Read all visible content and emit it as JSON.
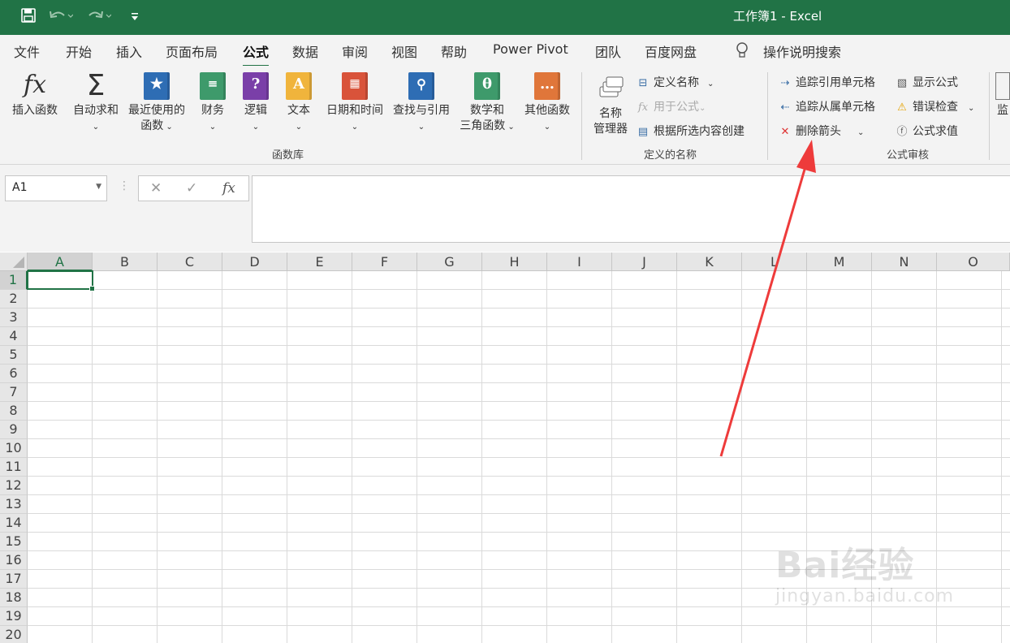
{
  "window": {
    "title": "工作簿1  -  Excel"
  },
  "quick_access": {
    "save_icon": "save-icon",
    "undo_icon": "undo-icon",
    "redo_icon": "redo-icon",
    "customize_icon": "customize-icon"
  },
  "tabs": [
    "文件",
    "开始",
    "插入",
    "页面布局",
    "公式",
    "数据",
    "审阅",
    "视图",
    "帮助",
    "Power Pivot",
    "团队",
    "百度网盘"
  ],
  "active_tab": "公式",
  "tell_me": "操作说明搜索",
  "ribbon": {
    "function_library": {
      "label": "函数库",
      "insert_function": "插入函数",
      "autosum": "自动求和",
      "recent_1": "最近使用的",
      "recent_2": "函数",
      "financial": "财务",
      "logical": "逻辑",
      "text": "文本",
      "datetime": "日期和时间",
      "lookup": "查找与引用",
      "math_1": "数学和",
      "math_2": "三角函数",
      "more": "其他函数"
    },
    "defined_names": {
      "label": "定义的名称",
      "name_manager_1": "名称",
      "name_manager_2": "管理器",
      "define_name": "定义名称",
      "use_in_formula": "用于公式",
      "create_from_selection": "根据所选内容创建"
    },
    "formula_auditing": {
      "label": "公式审核",
      "trace_precedents": "追踪引用单元格",
      "trace_dependents": "追踪从属单元格",
      "remove_arrows": "删除箭头",
      "show_formulas": "显示公式",
      "error_checking": "错误检查",
      "evaluate_formula": "公式求值",
      "watch": "监"
    }
  },
  "formula_bar": {
    "name_box": "A1",
    "fx": "fx",
    "formula": ""
  },
  "grid": {
    "columns": [
      "A",
      "B",
      "C",
      "D",
      "E",
      "F",
      "G",
      "H",
      "I",
      "J",
      "K",
      "L",
      "M",
      "N",
      "O"
    ],
    "rows": [
      "1",
      "2",
      "3",
      "4",
      "5",
      "6",
      "7",
      "8",
      "9",
      "10",
      "11",
      "12",
      "13",
      "14",
      "15",
      "16",
      "17",
      "18",
      "19",
      "20"
    ],
    "active_cell": "A1"
  },
  "colors": {
    "accent": "#217346",
    "annotation_arrow": "#ee3b3b"
  },
  "watermark": {
    "logo": "Bai经验",
    "url": "jingyan.baidu.com"
  }
}
